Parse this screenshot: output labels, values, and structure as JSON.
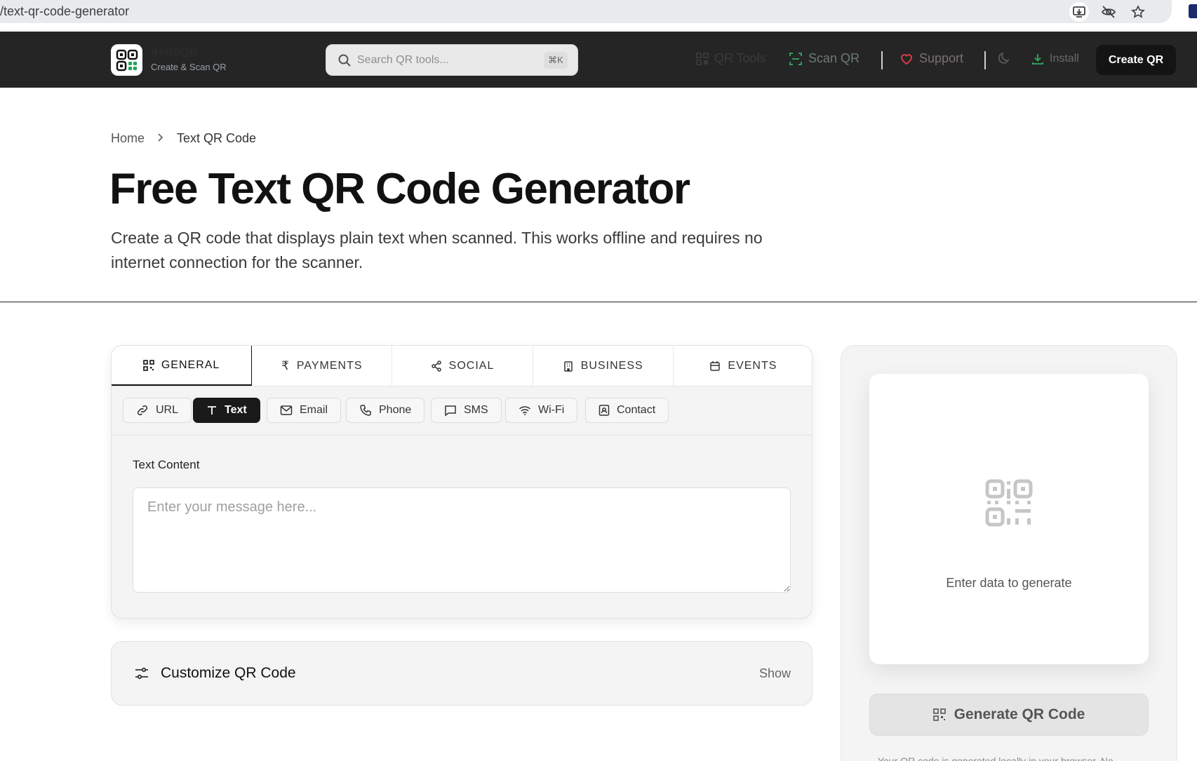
{
  "browser": {
    "url": "/text-qr-code-generator"
  },
  "header": {
    "brand_name": "iHateQR",
    "brand_sub": "Create & Scan QR",
    "search_placeholder": "Search QR tools...",
    "search_shortcut": "⌘K",
    "nav": {
      "qr_tools": "QR Tools",
      "scan_qr": "Scan QR",
      "support": "Support",
      "install": "Install",
      "create_qr": "Create QR"
    }
  },
  "breadcrumb": {
    "home": "Home",
    "separator": "›",
    "current": "Text QR Code"
  },
  "hero": {
    "title": "Free Text QR Code Generator",
    "description": "Create a QR code that displays plain text when scanned. This works offline and requires no internet connection for the scanner."
  },
  "form": {
    "category_tabs": [
      {
        "label": "GENERAL",
        "icon": "qr-grid-icon",
        "active": true
      },
      {
        "label": "PAYMENTS",
        "icon": "rupee-icon",
        "active": false
      },
      {
        "label": "SOCIAL",
        "icon": "share-icon",
        "active": false
      },
      {
        "label": "BUSINESS",
        "icon": "building-icon",
        "active": false
      },
      {
        "label": "EVENTS",
        "icon": "calendar-icon",
        "active": false
      }
    ],
    "types": [
      {
        "label": "URL",
        "icon": "link-icon"
      },
      {
        "label": "Text",
        "icon": "text-icon",
        "active": true
      },
      {
        "label": "Email",
        "icon": "mail-icon"
      },
      {
        "label": "Phone",
        "icon": "phone-icon"
      },
      {
        "label": "SMS",
        "icon": "message-icon"
      },
      {
        "label": "Wi-Fi",
        "icon": "wifi-icon"
      },
      {
        "label": "Contact",
        "icon": "contact-card-icon"
      }
    ],
    "field_label": "Text Content",
    "text_placeholder": "Enter your message here...",
    "text_value": ""
  },
  "customize": {
    "title": "Customize QR Code",
    "toggle": "Show"
  },
  "preview": {
    "empty_text": "Enter data to generate",
    "generate_label": "Generate QR Code",
    "footnote": "Your QR code is generated locally in your browser. No"
  },
  "colors": {
    "header_bg": "#252525",
    "scan_green": "#2e9e5b",
    "support_red": "#d93a4a",
    "install_green": "#2e9e5b",
    "active_dark": "#1a1a1a"
  }
}
